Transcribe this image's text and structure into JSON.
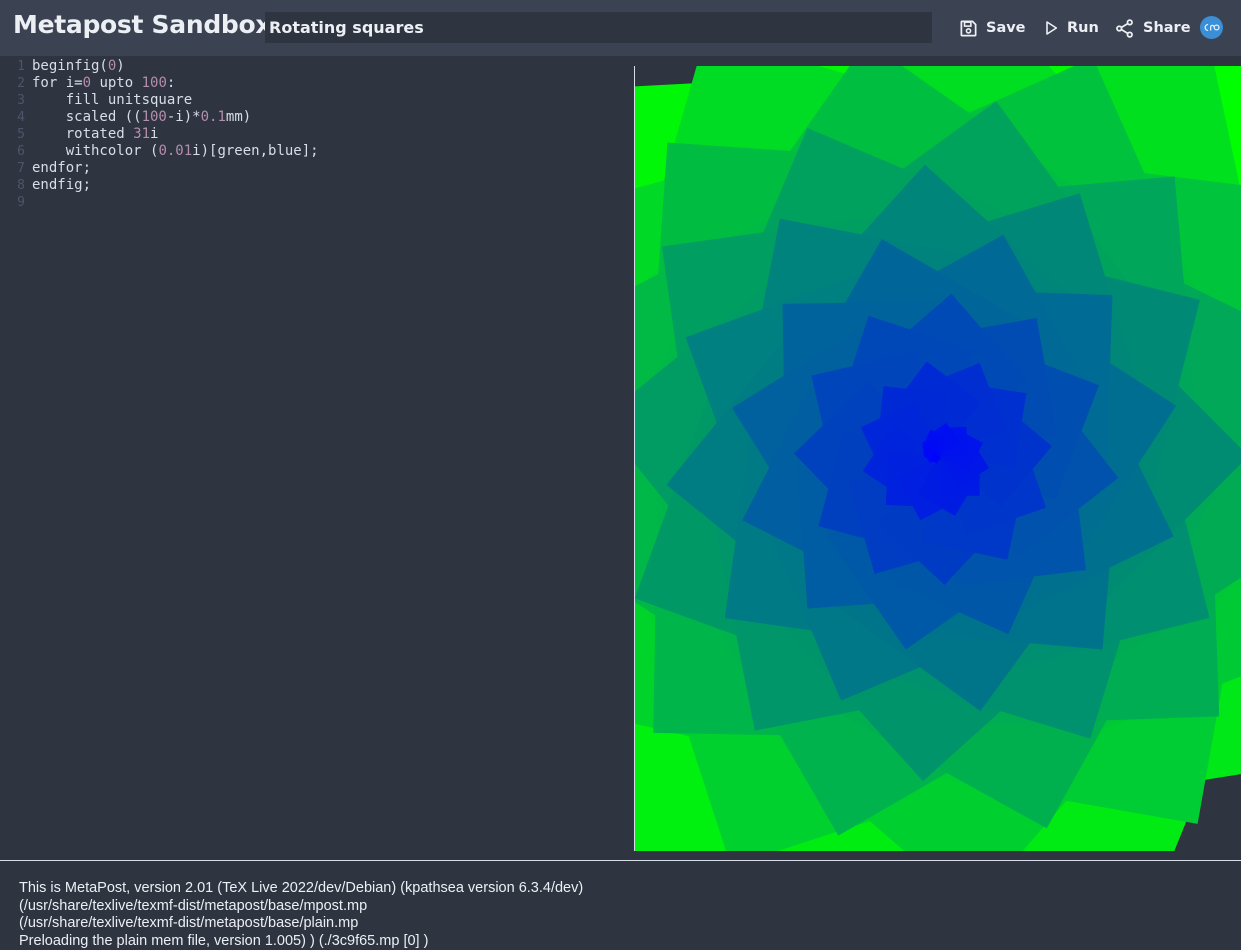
{
  "header": {
    "app_title": "Metapost Sandbox",
    "project_title": "Rotating squares",
    "save_label": "Save",
    "run_label": "Run",
    "share_label": "Share"
  },
  "editor": {
    "lines": [
      {
        "n": "1",
        "tokens": [
          [
            "t",
            "beginfig("
          ],
          [
            "n",
            "0"
          ],
          [
            "t",
            ")"
          ]
        ]
      },
      {
        "n": "2",
        "tokens": [
          [
            "t",
            "for i="
          ],
          [
            "n",
            "0"
          ],
          [
            "t",
            " upto "
          ],
          [
            "n",
            "100"
          ],
          [
            "t",
            ":"
          ]
        ]
      },
      {
        "n": "3",
        "tokens": [
          [
            "t",
            "    fill unitsquare"
          ]
        ]
      },
      {
        "n": "4",
        "tokens": [
          [
            "t",
            "    scaled (("
          ],
          [
            "n",
            "100"
          ],
          [
            "t",
            "-i)*"
          ],
          [
            "n",
            "0.1"
          ],
          [
            "t",
            "mm)"
          ]
        ]
      },
      {
        "n": "5",
        "tokens": [
          [
            "t",
            "    rotated "
          ],
          [
            "n",
            "31"
          ],
          [
            "t",
            "i"
          ]
        ]
      },
      {
        "n": "6",
        "tokens": [
          [
            "t",
            "    withcolor ("
          ],
          [
            "n",
            "0.01"
          ],
          [
            "t",
            "i)[green,blue];"
          ]
        ]
      },
      {
        "n": "7",
        "tokens": [
          [
            "t",
            "endfor;"
          ]
        ]
      },
      {
        "n": "8",
        "tokens": [
          [
            "t",
            "endfig;"
          ]
        ]
      },
      {
        "n": "9",
        "tokens": [
          [
            "t",
            ""
          ]
        ]
      }
    ]
  },
  "console": {
    "lines": [
      "This is MetaPost, version 2.01 (TeX Live 2022/dev/Debian) (kpathsea version 6.3.4/dev)",
      "(/usr/share/texlive/texmf-dist/metapost/base/mpost.mp",
      "(/usr/share/texlive/texmf-dist/metapost/base/plain.mp",
      "Preloading the plain mem file, version 1.005) ) (./3c9f65.mp [0] )"
    ]
  },
  "figure": {
    "count": 101,
    "rotation_step_deg": 31,
    "color_start": "#00ff00",
    "color_end": "#0000ff",
    "icons": [
      "save-icon",
      "play-icon",
      "share-icon",
      "avatar-icon"
    ]
  }
}
